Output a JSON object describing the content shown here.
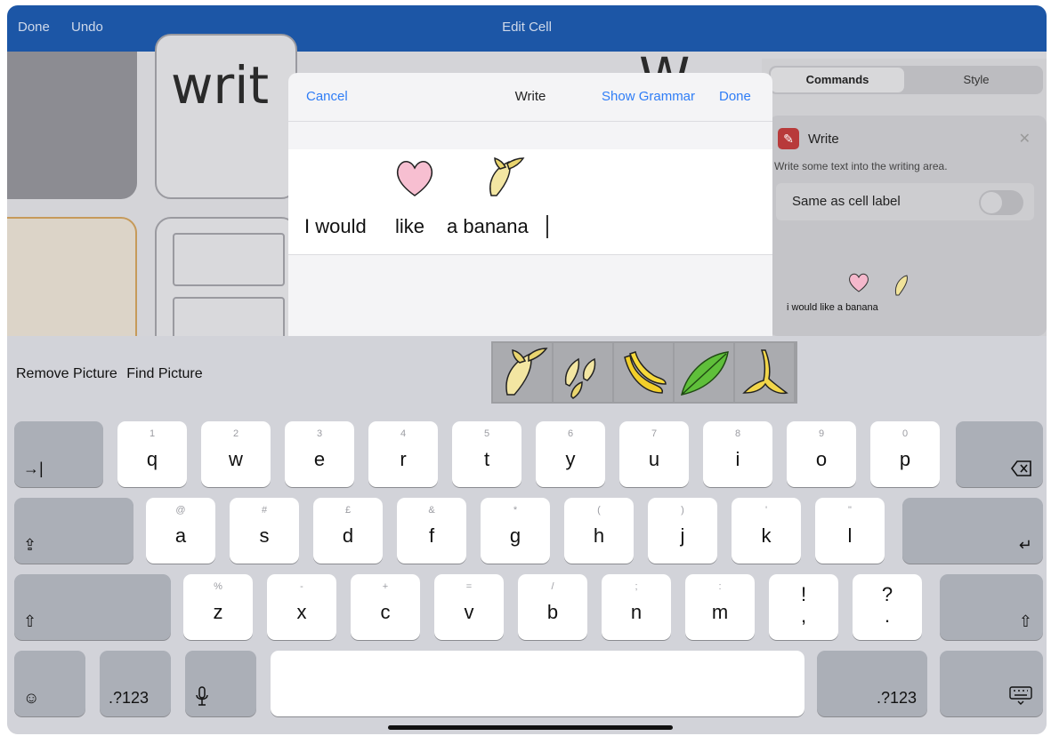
{
  "topbar": {
    "done": "Done",
    "undo": "Undo",
    "title": "Edit Cell"
  },
  "background": {
    "big_text_left": "writ",
    "big_text_right": "W"
  },
  "sidebar": {
    "tab_commands": "Commands",
    "tab_style": "Style",
    "command": {
      "title": "Write",
      "description": "Write some text into the writing area.",
      "same_as_label": "Same as cell label",
      "same_as_label_on": false,
      "preview_words": [
        "i would",
        "like",
        "a banana"
      ]
    }
  },
  "dialog": {
    "cancel": "Cancel",
    "title": "Write",
    "show_grammar": "Show Grammar",
    "done": "Done",
    "words": [
      "I would",
      "like",
      "a banana"
    ]
  },
  "keyboard": {
    "remove_picture": "Remove Picture",
    "find_picture": "Find Picture",
    "picture_options": [
      "peeled-banana",
      "banana-pieces",
      "banana-bunch",
      "banana-leaf",
      "banana-peel"
    ],
    "row1": [
      {
        "hint": "1",
        "key": "q"
      },
      {
        "hint": "2",
        "key": "w"
      },
      {
        "hint": "3",
        "key": "e"
      },
      {
        "hint": "4",
        "key": "r"
      },
      {
        "hint": "5",
        "key": "t"
      },
      {
        "hint": "6",
        "key": "y"
      },
      {
        "hint": "7",
        "key": "u"
      },
      {
        "hint": "8",
        "key": "i"
      },
      {
        "hint": "9",
        "key": "o"
      },
      {
        "hint": "0",
        "key": "p"
      }
    ],
    "row2": [
      {
        "hint": "@",
        "key": "a"
      },
      {
        "hint": "#",
        "key": "s"
      },
      {
        "hint": "£",
        "key": "d"
      },
      {
        "hint": "&",
        "key": "f"
      },
      {
        "hint": "*",
        "key": "g"
      },
      {
        "hint": "(",
        "key": "h"
      },
      {
        "hint": ")",
        "key": "j"
      },
      {
        "hint": "'",
        "key": "k"
      },
      {
        "hint": "\"",
        "key": "l"
      }
    ],
    "row3": [
      {
        "hint": "%",
        "key": "z"
      },
      {
        "hint": "-",
        "key": "x"
      },
      {
        "hint": "+",
        "key": "c"
      },
      {
        "hint": "=",
        "key": "v"
      },
      {
        "hint": "/",
        "key": "b"
      },
      {
        "hint": ";",
        "key": "n"
      },
      {
        "hint": ":",
        "key": "m"
      }
    ],
    "punct1": {
      "top": "!",
      "bottom": ","
    },
    "punct2": {
      "top": "?",
      "bottom": "."
    },
    "numbers_label": ".?123"
  }
}
